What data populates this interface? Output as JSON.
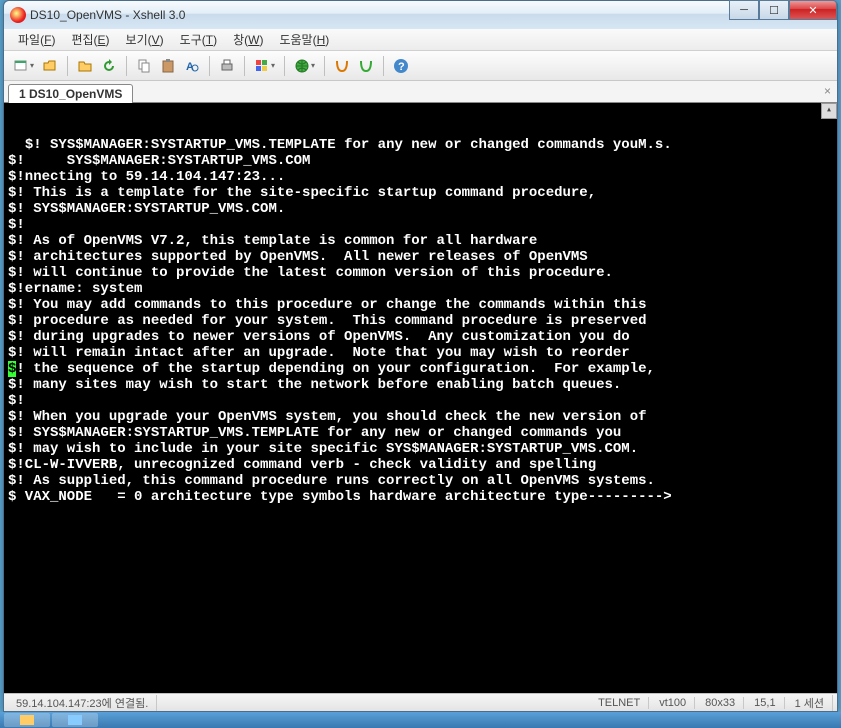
{
  "window": {
    "title": "DS10_OpenVMS - Xshell 3.0"
  },
  "menu": {
    "file": {
      "label": "파일",
      "hotkey": "F"
    },
    "edit": {
      "label": "편집",
      "hotkey": "E"
    },
    "view": {
      "label": "보기",
      "hotkey": "V"
    },
    "tools": {
      "label": "도구",
      "hotkey": "T"
    },
    "window": {
      "label": "창",
      "hotkey": "W"
    },
    "help": {
      "label": "도움말",
      "hotkey": "H"
    }
  },
  "toolbar": {
    "icons": [
      "new-session",
      "open-session",
      "sep",
      "disconnect",
      "reconnect",
      "sep",
      "copy",
      "paste",
      "find",
      "sep",
      "print",
      "sep",
      "color-scheme",
      "sep",
      "globe",
      "sep",
      "script-run",
      "script-stop",
      "sep",
      "help"
    ]
  },
  "tabs": {
    "active": "1 DS10_OpenVMS"
  },
  "terminal_lines": [
    "$! SYS$MANAGER:SYSTARTUP_VMS.TEMPLATE for any new or changed commands youM.s.",
    "$!     SYS$MANAGER:SYSTARTUP_VMS.COM",
    "$!nnecting to 59.14.104.147:23...",
    "$! This is a template for the site-specific startup command procedure,",
    "$! SYS$MANAGER:SYSTARTUP_VMS.COM.",
    "$!",
    "$! As of OpenVMS V7.2, this template is common for all hardware",
    "$! architectures supported by OpenVMS.  All newer releases of OpenVMS",
    "$! will continue to provide the latest common version of this procedure.",
    "$!ername: system",
    "$! You may add commands to this procedure or change the commands within this",
    "$! procedure as needed for your system.  This command procedure is preserved",
    "$! during upgrades to newer versions of OpenVMS.  Any customization you do",
    "$! will remain intact after an upgrade.  Note that you may wish to reorder",
    "$! the sequence of the startup depending on your configuration.  For example,",
    "$! many sites may wish to start the network before enabling batch queues.",
    "$!",
    "$! When you upgrade your OpenVMS system, you should check the new version of",
    "$! SYS$MANAGER:SYSTARTUP_VMS.TEMPLATE for any new or changed commands you",
    "$! may wish to include in your site specific SYS$MANAGER:SYSTARTUP_VMS.COM.",
    "$!CL-W-IVVERB, unrecognized command verb - check validity and spelling",
    "$! As supplied, this command procedure runs correctly on all OpenVMS systems.",
    "$ VAX_NODE   = 0 architecture type symbols hardware architecture type--------->"
  ],
  "cursor_line_index": 14,
  "status": {
    "host": "59.14.104.147:23에",
    "state": "연결됨.",
    "proto": "TELNET",
    "term": "vt100",
    "size": "80x33",
    "pos": "15,1",
    "sessions": "1 세션"
  }
}
